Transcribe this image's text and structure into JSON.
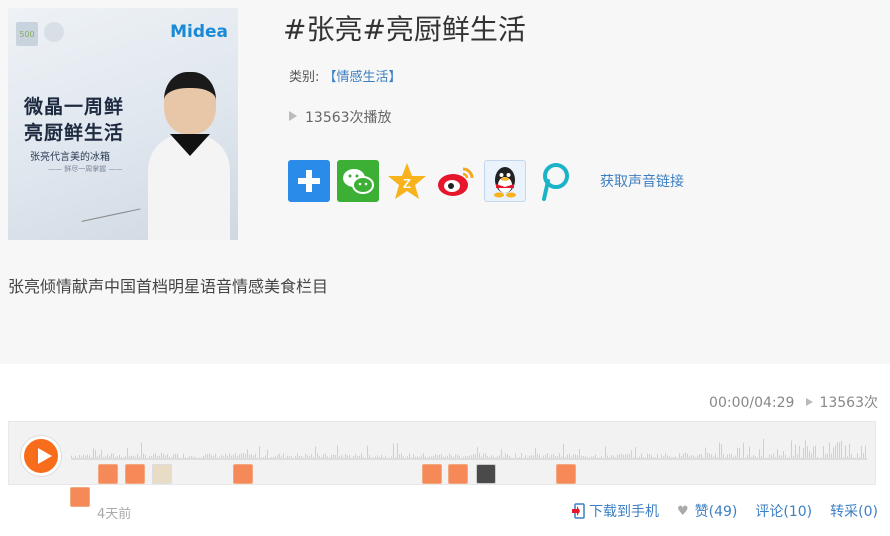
{
  "cover": {
    "brand_logo": "Midea",
    "slogan_line1": "微晶一周鲜",
    "slogan_line2": "亮厨鲜生活",
    "slogan_line3": "张亮代言美的冰箱",
    "slogan_line4": "—— 鲜尽一周掌握 ——"
  },
  "track": {
    "title": "#张亮#亮厨鲜生活",
    "category_label": "类别:",
    "category_value": "【情感生活】",
    "play_count": "13563次播放",
    "description": "张亮倾情献声中国首档明星语音情感美食栏目"
  },
  "share": {
    "icons": [
      "plus-share-icon",
      "wechat-icon",
      "qzone-icon",
      "weibo-icon",
      "qq-icon",
      "pengyou-icon"
    ],
    "get_link_label": "获取声音链接"
  },
  "player": {
    "time": "00:00/04:29",
    "plays": "13563次",
    "progress": 0,
    "accent_color": "#f86d1c"
  },
  "footer": {
    "ago": "4天前",
    "download_label": "下载到手机",
    "like_label": "赞(49)",
    "comment_label": "评论(10)",
    "repost_label": "转采(0)"
  }
}
